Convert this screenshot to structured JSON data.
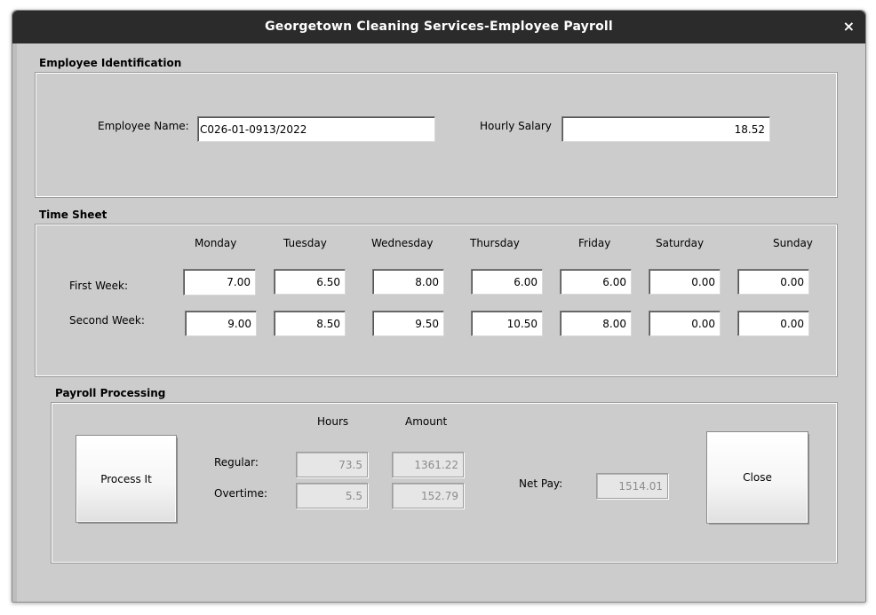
{
  "window": {
    "title": "Georgetown Cleaning Services-Employee Payroll",
    "close_glyph": "×"
  },
  "employee_identification": {
    "group_title": "Employee Identification",
    "name_label": "Employee Name:",
    "name_value": "C026-01-0913/2022",
    "salary_label": "Hourly Salary",
    "salary_value": "18.52"
  },
  "time_sheet": {
    "group_title": "Time Sheet",
    "days": [
      "Monday",
      "Tuesday",
      "Wednesday",
      "Thursday",
      "Friday",
      "Saturday",
      "Sunday"
    ],
    "weeks": [
      {
        "label": "First Week:",
        "hours": [
          "7.00",
          "6.50",
          "8.00",
          "6.00",
          "6.00",
          "0.00",
          "0.00"
        ]
      },
      {
        "label": "Second Week:",
        "hours": [
          "9.00",
          "8.50",
          "9.50",
          "10.50",
          "8.00",
          "0.00",
          "0.00"
        ]
      }
    ]
  },
  "payroll_processing": {
    "group_title": "Payroll Processing",
    "process_button": "Process It",
    "hours_header": "Hours",
    "amount_header": "Amount",
    "regular_label": "Regular:",
    "regular_hours": "73.5",
    "regular_amount": "1361.22",
    "overtime_label": "Overtime:",
    "overtime_hours": "5.5",
    "overtime_amount": "152.79",
    "net_pay_label": "Net Pay:",
    "net_pay_value": "1514.01",
    "close_button": "Close"
  },
  "icons": {
    "window_close": "close-icon"
  },
  "colors": {
    "titlebar": "#2b2b2b",
    "window_background": "#cccccc"
  }
}
